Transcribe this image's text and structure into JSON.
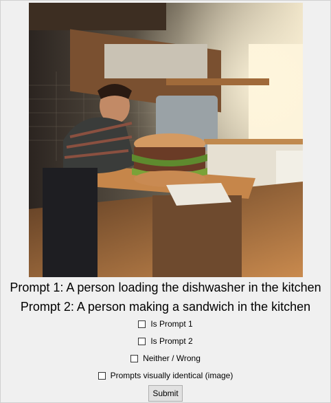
{
  "image": {
    "description_icon": "kitchen-sandwich-photo"
  },
  "prompts": {
    "prompt1": "Prompt 1: A person loading the dishwasher in the kitchen",
    "prompt2": "Prompt 2: A person making a sandwich in the kitchen"
  },
  "options": [
    {
      "label": "Is Prompt 1",
      "checked": false
    },
    {
      "label": "Is Prompt 2",
      "checked": false
    },
    {
      "label": "Neither / Wrong",
      "checked": false
    },
    {
      "label": "Prompts visually identical (image)",
      "checked": false
    }
  ],
  "submit_label": "Submit",
  "colors": {
    "background": "#f0f0f0",
    "button": "#e1e1e1"
  }
}
